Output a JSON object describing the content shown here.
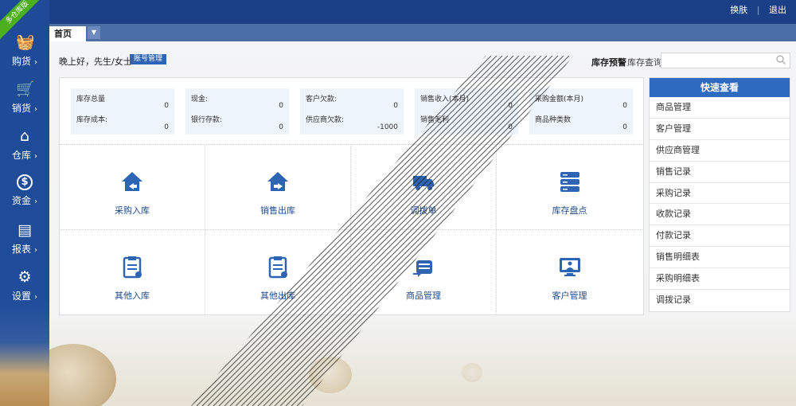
{
  "ribbon": "多仓库版",
  "topbar": {
    "skin": "换肤",
    "logout": "退出",
    "sep": "|"
  },
  "nav": [
    {
      "label": "购货",
      "icon": "basket-icon",
      "glyph": "🧺"
    },
    {
      "label": "销货",
      "icon": "cart-icon",
      "glyph": "🛒"
    },
    {
      "label": "仓库",
      "icon": "warehouse-icon",
      "glyph": "⌂"
    },
    {
      "label": "资金",
      "icon": "dollar-icon",
      "glyph": "$"
    },
    {
      "label": "报表",
      "icon": "report-icon",
      "glyph": "▤"
    },
    {
      "label": "设置",
      "icon": "gear-icon",
      "glyph": "⚙"
    }
  ],
  "nav_arrow": "›",
  "tabs": {
    "home": "首页",
    "more": "▼"
  },
  "greeting": "晚上好，先生/女士",
  "account_button": "账号管理",
  "stock_alert": "库存预警",
  "stock_query": "库存查询",
  "search": {
    "value": "",
    "placeholder": ""
  },
  "stats": [
    {
      "k1": "库存总量",
      "v1": "0",
      "k2": "库存成本:",
      "v2": "0"
    },
    {
      "k1": "现金:",
      "v1": "0",
      "k2": "银行存款:",
      "v2": "0"
    },
    {
      "k1": "客户欠款:",
      "v1": "0",
      "k2": "供应商欠款:",
      "v2": "-1000"
    },
    {
      "k1": "销售收入(本月)",
      "v1": "0",
      "k2": "销售毛利",
      "v2": "0"
    },
    {
      "k1": "采购金额(本月)",
      "v1": "0",
      "k2": "商品种类数",
      "v2": "0"
    }
  ],
  "tiles": [
    {
      "label": "采购入库",
      "icon": "house-in-icon"
    },
    {
      "label": "销售出库",
      "icon": "house-out-icon"
    },
    {
      "label": "调拨单",
      "icon": "truck-icon"
    },
    {
      "label": "库存盘点",
      "icon": "database-icon"
    },
    {
      "label": "其他入库",
      "icon": "clipboard-icon"
    },
    {
      "label": "其他出库",
      "icon": "clipboard-out-icon"
    },
    {
      "label": "商品管理",
      "icon": "product-icon"
    },
    {
      "label": "客户管理",
      "icon": "monitor-user-icon"
    }
  ],
  "quick": {
    "title": "快速查看",
    "items": [
      "商品管理",
      "客户管理",
      "供应商管理",
      "销售记录",
      "采购记录",
      "收款记录",
      "付款记录",
      "销售明细表",
      "采购明细表",
      "调拨记录"
    ]
  },
  "colors": {
    "nav_blue": "#1f4d9a",
    "accent": "#2e6bc0",
    "tile_text": "#1e4a8a",
    "ribbon_green": "#4caf1e"
  }
}
